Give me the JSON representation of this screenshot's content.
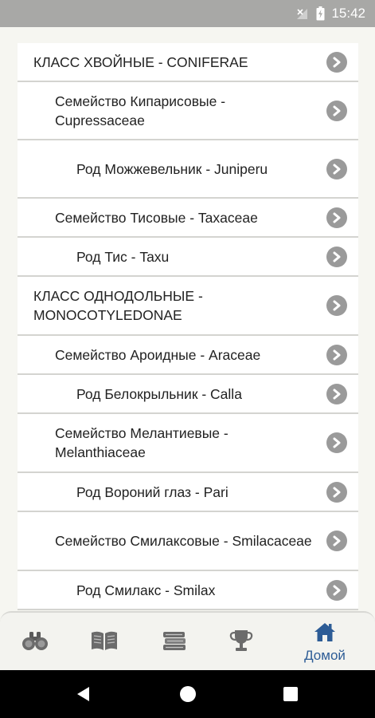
{
  "status_bar": {
    "time": "15:42"
  },
  "items": [
    {
      "label": "КЛАСС ХВОЙНЫЕ - CONIFERAE",
      "level": 0
    },
    {
      "label": "Семейство Кипарисовые - Cupressaceae",
      "level": 1
    },
    {
      "label": "Род Можжевельник - Juniperu",
      "level": 2
    },
    {
      "label": "Семейство Тисовые - Taxaceae",
      "level": 1
    },
    {
      "label": "Род Тис - Taxu",
      "level": 2
    },
    {
      "label": "КЛАСС ОДНОДОЛЬНЫЕ - MONOCOTYLEDONAE",
      "level": 0
    },
    {
      "label": "Семейство Ароидные - Araceae",
      "level": 1
    },
    {
      "label": "Род Белокрыльник - Calla",
      "level": 2
    },
    {
      "label": "Семейство Мелантиевые - Melanthiaceae",
      "level": 1
    },
    {
      "label": "Род Вороний глаз - Pari",
      "level": 2
    },
    {
      "label": "Семейство Смилаксовые - Smilacaceae",
      "level": 1
    },
    {
      "label": "Род Смилакс - Smilax",
      "level": 2
    }
  ],
  "bottom_nav": {
    "tabs": [
      {
        "icon": "binoculars-icon"
      },
      {
        "icon": "open-book-icon"
      },
      {
        "icon": "books-stack-icon"
      },
      {
        "icon": "trophy-icon"
      },
      {
        "icon": "home-icon",
        "label": "Домой",
        "active": true
      }
    ],
    "active_color": "#2d5c96",
    "icon_color": "#6b6b6b"
  },
  "colors": {
    "background": "#f6f6f1",
    "row_background": "#ffffff",
    "chevron": "#9a9a9a",
    "status_bar": "#a8a8a6"
  }
}
